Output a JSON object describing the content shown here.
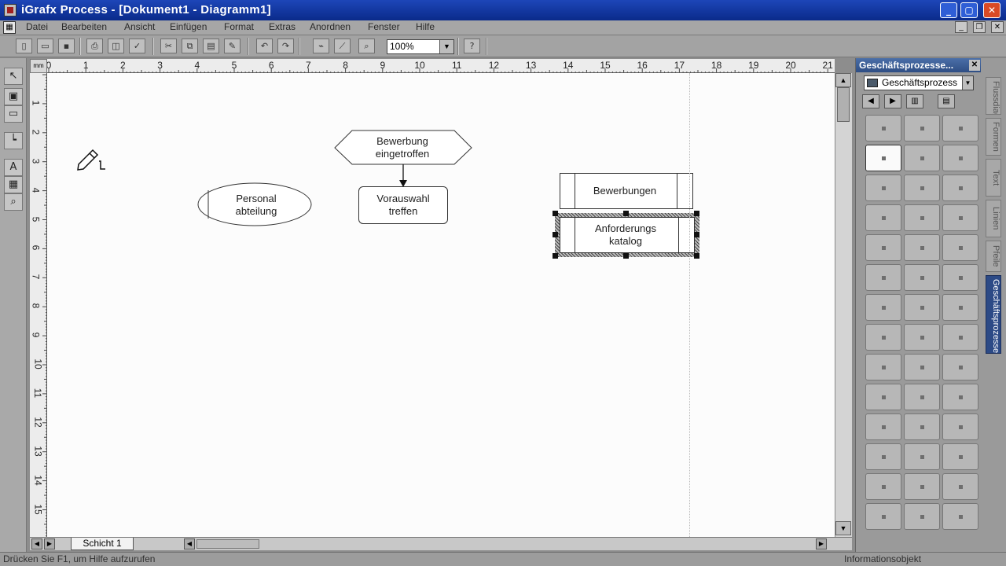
{
  "window": {
    "title": "iGrafx Process - [Dokument1 - Diagramm1]",
    "controls": {
      "minimize": "_",
      "maximize": "▢",
      "close": "✕"
    },
    "mdi_controls": {
      "minimize": "_",
      "restore": "❐",
      "close": "✕"
    }
  },
  "menu": {
    "items": [
      "Datei",
      "Bearbeiten",
      "Ansicht",
      "Einfügen",
      "Format",
      "Extras",
      "Anordnen",
      "Fenster",
      "Hilfe"
    ]
  },
  "toolbar": {
    "icons": [
      "new-icon",
      "open-icon",
      "save-icon",
      "print-icon",
      "print-preview-icon",
      "spell-check-icon",
      "cut-icon",
      "copy-icon",
      "paste-icon",
      "format-painter-icon",
      "undo-icon",
      "redo-icon",
      "connect-icon",
      "connector-style-icon",
      "zoom-icon",
      "help-icon"
    ],
    "zoom_value": "100%"
  },
  "ruler": {
    "unit": "mm",
    "h_labels": [
      "0",
      "1",
      "2",
      "3",
      "4",
      "5",
      "6",
      "7",
      "8",
      "9",
      "10",
      "11",
      "12",
      "13",
      "14",
      "15",
      "16",
      "17",
      "18",
      "19",
      "20",
      "21"
    ],
    "v_labels": [
      "1",
      "2",
      "3",
      "4",
      "5",
      "6",
      "7",
      "8",
      "9",
      "10",
      "11",
      "12",
      "13",
      "14",
      "15"
    ]
  },
  "diagram": {
    "shapes": [
      {
        "id": "hexagon",
        "type": "event",
        "text": "Bewerbung\neingetroffen"
      },
      {
        "id": "rounded-rect",
        "type": "activity",
        "text": "Vorauswahl\ntreffen"
      },
      {
        "id": "ellipse",
        "type": "department",
        "text": "Personal\nabteilung"
      },
      {
        "id": "doc-1",
        "type": "document",
        "text": "Bewerbungen"
      },
      {
        "id": "doc-2",
        "type": "document",
        "text": "Anforderungs\nkatalog",
        "selected": true
      }
    ]
  },
  "layers": {
    "active_tab": "Schicht 1"
  },
  "status": {
    "left": "Drücken Sie F1, um Hilfe aufzurufen",
    "right": "Informationsobjekt"
  },
  "shape_panel": {
    "title": "Geschäftsprozesse...",
    "library": "Geschäftsprozess",
    "side_tabs": [
      "Flussdiagramm",
      "Formen",
      "Text",
      "Linien",
      "Pfeile",
      "Geschäftsprozesse"
    ],
    "active_side_tab": "Geschäftsprozesse"
  },
  "colors": {
    "title_bar": "#0a2a8a",
    "selection_handle": "#111111",
    "panel_active_tab": "#2c4a86"
  }
}
